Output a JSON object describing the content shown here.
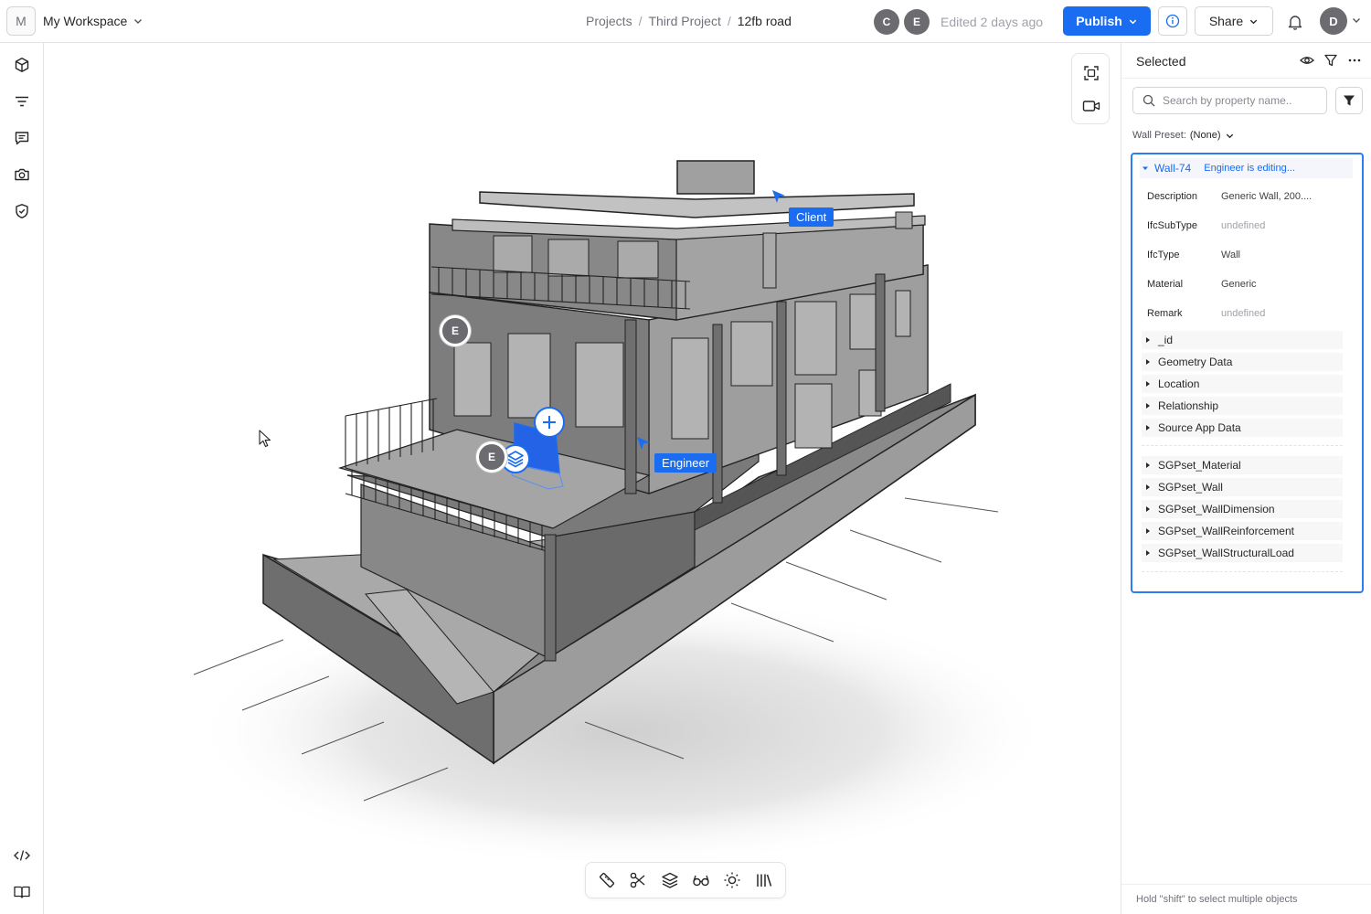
{
  "header": {
    "workspace_initial": "M",
    "workspace_name": "My Workspace",
    "breadcrumb": [
      "Projects",
      "Third Project",
      "12fb road"
    ],
    "collaborators": [
      "C",
      "E"
    ],
    "edited_text": "Edited 2 days ago",
    "publish_label": "Publish",
    "share_label": "Share",
    "user_initial": "D"
  },
  "viewer": {
    "cursor_labels": {
      "client": "Client",
      "engineer": "Engineer"
    },
    "markers": [
      "E",
      "E"
    ],
    "toolbar_icons": [
      "ruler-icon",
      "scissors-icon",
      "layers-icon",
      "glasses-icon",
      "sun-icon",
      "library-icon"
    ]
  },
  "panel": {
    "title": "Selected",
    "search_placeholder": "Search by property name..",
    "preset_label": "Wall Preset:",
    "preset_value": "(None)",
    "wall": {
      "name": "Wall-74",
      "status": "Engineer is editing...",
      "properties": [
        {
          "key": "Description",
          "value": "Generic Wall, 200...."
        },
        {
          "key": "IfcSubType",
          "value": "undefined"
        },
        {
          "key": "IfcType",
          "value": "Wall"
        },
        {
          "key": "Material",
          "value": "Generic"
        },
        {
          "key": "Remark",
          "value": "undefined"
        }
      ],
      "groups": [
        "_id",
        "Geometry Data",
        "Location",
        "Relationship",
        "Source App Data"
      ],
      "psets": [
        "SGPset_Material",
        "SGPset_Wall",
        "SGPset_WallDimension",
        "SGPset_WallReinforcement",
        "SGPset_WallStructuralLoad"
      ]
    },
    "footer": "Hold \"shift\" to select multiple objects"
  },
  "colors": {
    "accent": "#1a6cf0",
    "avatar": "#6b6b70",
    "border": "#e4e4e7"
  }
}
